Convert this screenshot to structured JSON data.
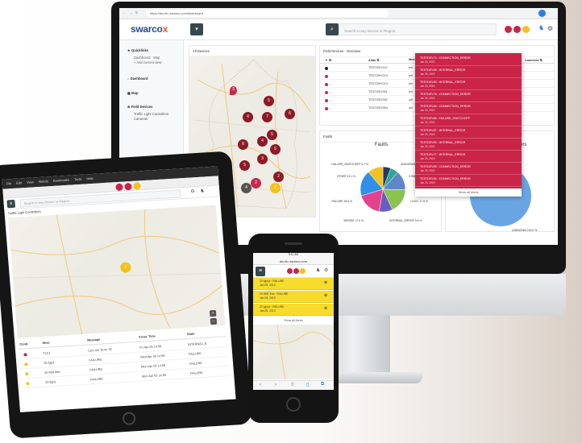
{
  "monitor": {
    "browser": {
      "url": "https://dev.tlc-swarco.com/dashboard"
    },
    "logo": {
      "text": "swarco",
      "mark": "x"
    },
    "search": {
      "placeholder": "Search in any Device or Region"
    },
    "user_badges": [
      {
        "color": "#ca2549"
      },
      {
        "color": "#ca2549"
      },
      {
        "color": "#f2c21b"
      }
    ],
    "sidebar": {
      "quicklinks_title": "Quicklinks",
      "quicklinks_items": [
        "Dashboard · Map",
        "+ Add current view"
      ],
      "dashboard": "Dashboard",
      "map": "Map",
      "field_devices": "Field Devices",
      "field_items": [
        "Traffic Light Controllers",
        "Cameras"
      ]
    },
    "all_devices": {
      "title": "All Devices"
    },
    "field_devices_overview": {
      "title": "Field Devices - Overview",
      "columns": [
        "▼ ⚙",
        "Alias ⇅",
        "Mess",
        "Comment ⇅"
      ],
      "rows": [
        {
          "alias": "TESTDEV112",
          "msg": "unl",
          "dot": "#222222"
        },
        {
          "alias": "TESTDEV213",
          "msg": "unl",
          "dot": "#ca2549"
        },
        {
          "alias": "TESTDEV214",
          "msg": "unl",
          "dot": "#ca2549"
        },
        {
          "alias": "TESTDEV351",
          "msg": "unl",
          "dot": "#ca2549"
        },
        {
          "alias": "TESTDEV352",
          "msg": "unl",
          "dot": "#ca2549"
        },
        {
          "alias": "TESTDEV354",
          "msg": "unl",
          "dot": "#ca2549"
        }
      ]
    },
    "alerts": [
      {
        "title": "TESTDEV74 : CONNECTION_ERROR",
        "date": "Jan 25, 2019"
      },
      {
        "title": "TESTDEV88 : INTERNAL_ERROR",
        "date": "Jan 25, 2019"
      },
      {
        "title": "TESTDEV83 : INTERNAL_ERROR",
        "date": "Jan 25, 2019"
      },
      {
        "title": "TESTDEV76 : CONNECTION_ERROR",
        "date": "Jan 25, 2019"
      },
      {
        "title": "TESTDEV84 : CONNECTION_ERROR",
        "date": "Jan 25, 2019"
      },
      {
        "title": "TESTDEV86 : FAILURE_SWITCHOFF",
        "date": "Jan 25, 2019"
      },
      {
        "title": "TESTDEV87 : INTERNAL_ERROR",
        "date": "Jan 25, 2019"
      },
      {
        "title": "TESTDEV90 : INTERNAL_ERROR",
        "date": "Jan 25, 2019"
      },
      {
        "title": "TESTDEV77 : INTERNAL_ERROR",
        "date": "Jan 25, 2019"
      },
      {
        "title": "TESTDEV85 : CONNECTION_ERROR",
        "date": "Jan 25, 2019"
      },
      {
        "title": "TESTDEV82 : CONNECTION_ERROR",
        "date": "Jan 25, 2019"
      }
    ],
    "show_all_alerts": "Show all Alerts",
    "faults_panel": {
      "header": "Faults",
      "title": "Faults"
    },
    "states_panel": {
      "title": "ers"
    },
    "map_pins": [
      {
        "label": "3",
        "color": "#c72a4c"
      },
      {
        "label": "5",
        "color": "#8e1a25"
      },
      {
        "label": "4",
        "color": "#8e1a25"
      },
      {
        "label": "7",
        "color": "#8e1a25"
      },
      {
        "label": "6",
        "color": "#8e1a25"
      },
      {
        "label": "5",
        "color": "#8e1a25"
      },
      {
        "label": "4",
        "color": "#8e1a25"
      },
      {
        "label": "8",
        "color": "#8e1a25"
      },
      {
        "label": "5",
        "color": "#8e1a25"
      },
      {
        "label": "3",
        "color": "#8e1a25"
      },
      {
        "label": "5",
        "color": "#8e1a25"
      },
      {
        "label": "2",
        "color": "#8e1a25"
      },
      {
        "label": "2",
        "color": "#c72a4c"
      },
      {
        "label": "4",
        "color": "#555555"
      },
      {
        "label": "2",
        "color": "#f2c21b"
      }
    ]
  },
  "chart_data": [
    {
      "type": "pie",
      "title": "Faults",
      "categories": [
        "FAILURE_SWITCHOFF",
        "UNKNOWN",
        "CONN",
        "LOGIC",
        "INTERNAL_ERROR",
        "MISSED",
        "FAILURE",
        "OTHER"
      ],
      "values": [
        5.7,
        5.7,
        13.9,
        17.6,
        9.6,
        17.6,
        18.5,
        11.1
      ],
      "data_labels": [
        "FAILURE_SWITCHOFF 5.7 %",
        "UNKNOWN 5.7 %",
        "CONN",
        "LOGIC 17.6 %",
        "INTERNAL_ERROR 9.6 %",
        "MISSED 17.6 %",
        "FAILURE 18.5 %",
        "OTHER 11.1 %"
      ],
      "colors": [
        "#243a6b",
        "#2aa89a",
        "#5f86c9",
        "#8cc24f",
        "#6b5dbf",
        "#e3428f",
        "#2f90e6",
        "#f0c222"
      ]
    },
    {
      "type": "pie",
      "title": "ers",
      "categories": [
        "UNKNOWN"
      ],
      "values": [
        100.0
      ],
      "data_labels": [
        "UNKNOWN 100.0 %"
      ],
      "colors": [
        "#6aa5e3"
      ]
    }
  ],
  "tablet": {
    "tabs": [
      "File",
      "Edit",
      "View",
      "History",
      "Bookmarks",
      "Tools",
      "Help"
    ],
    "search": {
      "placeholder": "Search in any Device or Region"
    },
    "breadcrumb": "Traffic Light Controllers",
    "table": {
      "columns": [
        "Cond.",
        "Alias",
        "Message",
        "Creat. Time",
        "State"
      ],
      "rows": [
        {
          "alias": "TLC1",
          "msg": "Lam set: Error 32",
          "time": "Fri Apr 05 14:56",
          "state": "INTERNAL_E"
        },
        {
          "alias": "20 fg(x)",
          "msg": "FAILURE",
          "time": "Wed Apr 05 14:56",
          "state": "FAILURE"
        },
        {
          "alias": "20 Mat Alex",
          "msg": "FAILURE",
          "time": "Mon Apr 05 14:56",
          "state": "FAILURE"
        },
        {
          "alias": "20 fg(x)",
          "msg": "FAILURE",
          "time": "Mon Apr 05 14:56",
          "state": "FAILURE"
        }
      ]
    }
  },
  "phone": {
    "url": "dev.tlc-swarco.com",
    "status": "9:41 AM",
    "alerts": [
      {
        "title": "20 fg(x)4 : FAILURE",
        "date": "Jan 25, 2019"
      },
      {
        "title": "20 SDE Exe : FAILURE",
        "date": "Jan 25, 2019"
      },
      {
        "title": "20 fg(x)4 : FAILURE",
        "date": "Jan 25, 2019"
      }
    ],
    "show_all": "Show all Alerts"
  }
}
